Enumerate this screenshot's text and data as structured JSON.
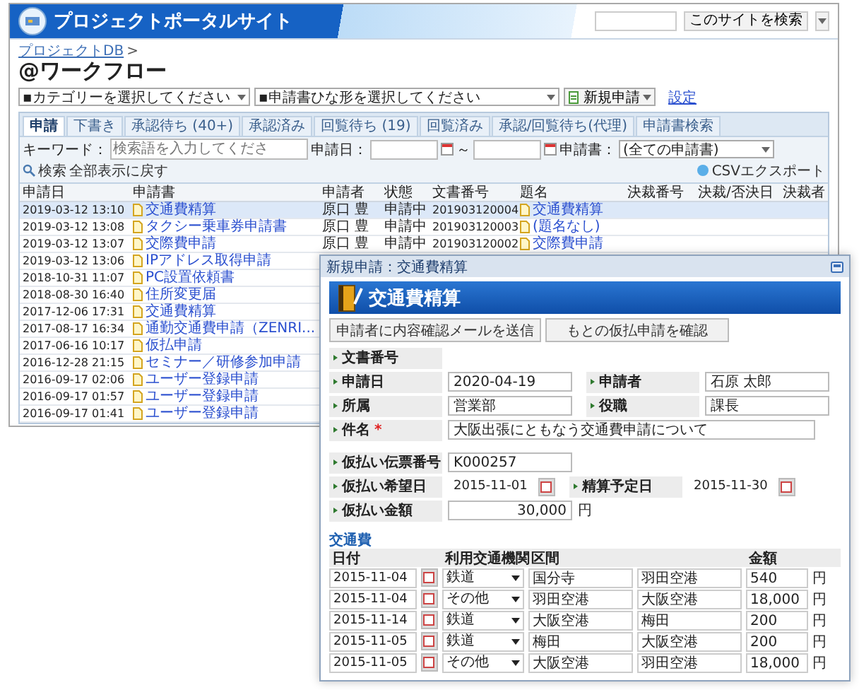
{
  "portal": {
    "site_title": "プロジェクトポータルサイト",
    "site_search_button": "このサイトを検索",
    "breadcrumb": "プロジェクトDB",
    "breadcrumb_sep": ">",
    "page_title": "@ワークフロー",
    "toolbar": {
      "category_select": "▪カテゴリーを選択してください",
      "template_select": "▪申請書ひな形を選択してください",
      "new_button": "新規申請",
      "settings_link": "設定"
    },
    "tabs": [
      {
        "label": "申請",
        "selected": true
      },
      {
        "label": "下書き",
        "selected": false
      },
      {
        "label": "承認待ち (40+)",
        "selected": false
      },
      {
        "label": "承認済み",
        "selected": false
      },
      {
        "label": "回覧待ち (19)",
        "selected": false
      },
      {
        "label": "回覧済み",
        "selected": false
      },
      {
        "label": "承認/回覧待ち(代理)",
        "selected": false
      },
      {
        "label": "申請書検索",
        "selected": false
      }
    ],
    "filter": {
      "keyword_label": "キーワード：",
      "keyword_placeholder": "検索語を入力してくださ",
      "date_label": "申請日：",
      "range_sep": "～",
      "form_label": "申請書：",
      "form_select": "(全ての申請書)",
      "search_button": "検索",
      "reset_link": "全部表示に戻す",
      "csv_button": "CSVエクスポート"
    },
    "table": {
      "columns": [
        {
          "label": "申請日",
          "kind": "date"
        },
        {
          "label": "申請書",
          "kind": "link"
        },
        {
          "label": "申請者",
          "kind": "text"
        },
        {
          "label": "状態",
          "kind": "text"
        },
        {
          "label": "文書番号",
          "kind": "number"
        },
        {
          "label": "題名",
          "kind": "link"
        },
        {
          "label": "決裁番号"
        },
        {
          "label": "決裁/否決日"
        },
        {
          "label": "決裁者"
        }
      ],
      "rows": [
        {
          "selected": true,
          "cells": [
            "2019-03-12 13:10",
            "交通費精算",
            "原口 豊",
            "申請中",
            "201903120004",
            "交通費精算"
          ]
        },
        {
          "selected": false,
          "cells": [
            "2019-03-12 13:08",
            "タクシー乗車券申請書",
            "原口 豊",
            "申請中",
            "201903120003",
            "(題名なし)"
          ]
        },
        {
          "selected": false,
          "cells": [
            "2019-03-12 13:07",
            "交際費申請",
            "原口 豊",
            "申請中",
            "201903120002",
            "交際費申請"
          ]
        },
        {
          "selected": false,
          "cells": [
            "2019-03-12 13:06",
            "IPアドレス取得申請"
          ]
        },
        {
          "selected": false,
          "cells": [
            "2018-10-31 11:07",
            "PC設置依頼書"
          ]
        },
        {
          "selected": false,
          "cells": [
            "2018-08-30 16:40",
            "住所変更届"
          ]
        },
        {
          "selected": false,
          "cells": [
            "2017-12-06 17:31",
            "交通費精算"
          ]
        },
        {
          "selected": false,
          "cells": [
            "2017-08-17 16:34",
            "通勤交通費申請（ZENRI..."
          ]
        },
        {
          "selected": false,
          "cells": [
            "2017-06-16 10:17",
            "仮払申請"
          ]
        },
        {
          "selected": false,
          "cells": [
            "2016-12-28 21:15",
            "セミナー／研修参加申請"
          ]
        },
        {
          "selected": false,
          "cells": [
            "2016-09-17 02:06",
            "ユーザー登録申請"
          ]
        },
        {
          "selected": false,
          "cells": [
            "2016-09-17 01:57",
            "ユーザー登録申請"
          ]
        },
        {
          "selected": false,
          "cells": [
            "2016-09-17 01:41",
            "ユーザー登録申請"
          ]
        }
      ]
    }
  },
  "dialog": {
    "title": "新規申請：交通費精算",
    "heading": "交通費精算",
    "buttons": [
      "申請者に内容確認メールを送信",
      "もとの仮払申請を確認"
    ],
    "fields": [
      [
        {
          "label": "文書番号",
          "kind": "static"
        }
      ],
      [
        {
          "label": "申請日",
          "kind": "text",
          "value": "2020-04-19"
        },
        {
          "label": "申請者",
          "kind": "text",
          "value": "石原 太郎"
        }
      ],
      [
        {
          "label": "所属",
          "kind": "text",
          "value": "営業部"
        },
        {
          "label": "役職",
          "kind": "text",
          "value": "課長"
        }
      ],
      [
        {
          "label": "件名",
          "kind": "wide",
          "required_mark": "*",
          "value": "大阪出張にともなう交通費申請について"
        }
      ]
    ],
    "advance_fields": [
      [
        {
          "label": "仮払い伝票番号",
          "kind": "text",
          "value": "K000257"
        }
      ],
      [
        {
          "label": "仮払い希望日",
          "kind": "date",
          "value": "2015-11-01"
        },
        {
          "label": "精算予定日",
          "kind": "date",
          "value": "2015-11-30"
        }
      ],
      [
        {
          "label": "仮払い金額",
          "kind": "amount",
          "value": "30,000",
          "unit": "円"
        }
      ]
    ],
    "expenses": {
      "title": "交通費",
      "columns": [
        "日付",
        "利用交通機関",
        "区間",
        "金額"
      ],
      "rows": [
        {
          "date": "2015-11-04",
          "transport": "鉄道",
          "from": "国分寺",
          "to": "羽田空港",
          "amount": "540",
          "unit": "円"
        },
        {
          "date": "2015-11-04",
          "transport": "その他",
          "from": "羽田空港",
          "to": "大阪空港",
          "amount": "18,000",
          "unit": "円"
        },
        {
          "date": "2015-11-14",
          "transport": "鉄道",
          "from": "大阪空港",
          "to": "梅田",
          "amount": "200",
          "unit": "円"
        },
        {
          "date": "2015-11-05",
          "transport": "鉄道",
          "from": "梅田",
          "to": "大阪空港",
          "amount": "200",
          "unit": "円"
        },
        {
          "date": "2015-11-05",
          "transport": "その他",
          "from": "大阪空港",
          "to": "羽田空港",
          "amount": "18,000",
          "unit": "円"
        }
      ]
    }
  }
}
